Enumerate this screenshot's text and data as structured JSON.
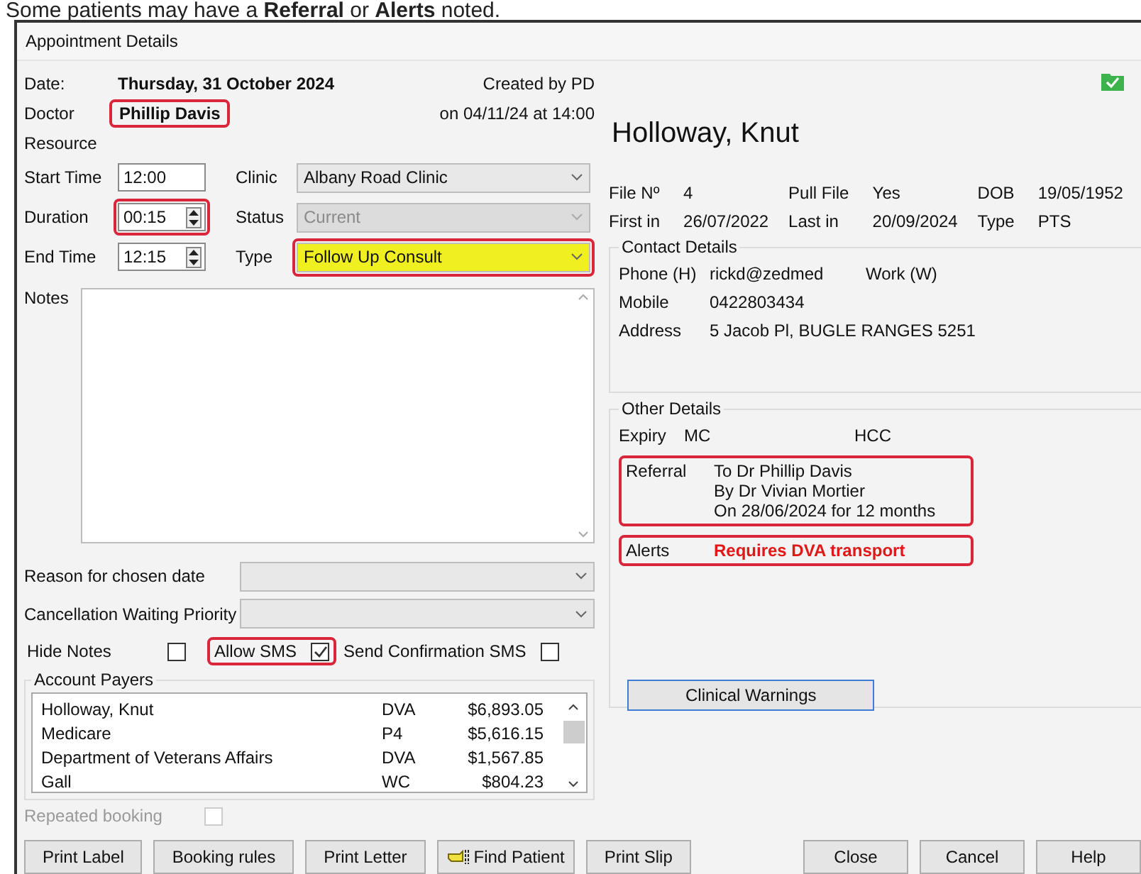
{
  "caption": "Some patients may have a **Referral** or **Alerts** noted.",
  "window": {
    "title": "Appointment Details"
  },
  "header": {
    "date_label": "Date:",
    "date": "Thursday, 31 October 2024",
    "created_by": "Created by PD",
    "doctor_label": "Doctor",
    "doctor": "Phillip Davis",
    "doctor_highlighted": true,
    "created_on": "on 04/11/24 at 14:00",
    "resource_label": "Resource"
  },
  "time_fields": [
    {
      "label": "Start Time",
      "value": "12:00",
      "spinner": false,
      "highlighted": false
    },
    {
      "label": "Duration",
      "value": "00:15",
      "spinner": true,
      "highlighted": true
    },
    {
      "label": "End Time",
      "value": "12:15",
      "spinner": true,
      "highlighted": false
    }
  ],
  "selects": [
    {
      "label": "Clinic",
      "value": "Albany Road Clinic",
      "disabled": false,
      "highlighted": false
    },
    {
      "label": "Status",
      "value": "Current",
      "disabled": true,
      "highlighted": false
    },
    {
      "label": "Type",
      "value": "Follow Up Consult",
      "disabled": false,
      "highlighted": true
    }
  ],
  "notes_label": "Notes",
  "wide_selects": [
    {
      "label": "Reason for chosen date"
    },
    {
      "label": "Cancellation Waiting Priority"
    }
  ],
  "checkboxes": [
    {
      "label": "Hide Notes",
      "checked": false,
      "highlighted": false
    },
    {
      "label": "Allow SMS",
      "checked": true,
      "highlighted": true
    },
    {
      "label": "Send Confirmation SMS",
      "checked": false,
      "highlighted": false
    }
  ],
  "account_payers": {
    "title": "Account Payers",
    "rows": [
      {
        "name": "Holloway, Knut",
        "code": "DVA",
        "amount": "$6,893.05"
      },
      {
        "name": "Medicare",
        "code": "P4",
        "amount": "$5,616.15"
      },
      {
        "name": "Department of Veterans Affairs",
        "code": "DVA",
        "amount": "$1,567.85"
      },
      {
        "name": "Gall",
        "code": "WC",
        "amount": "$804.23"
      }
    ]
  },
  "repeated_booking": {
    "label": "Repeated booking",
    "checked": false,
    "disabled": true
  },
  "left_buttons": [
    {
      "label": "Print Label"
    },
    {
      "label": "Booking rules"
    },
    {
      "label": "Print Letter"
    },
    {
      "label": "Find Patient",
      "kind": "icon"
    },
    {
      "label": "Print Slip"
    }
  ],
  "right_buttons": [
    {
      "label": "Close"
    },
    {
      "label": "Cancel"
    },
    {
      "label": "Help"
    }
  ],
  "patient": {
    "name": "Holloway, Knut",
    "info_rows": [
      [
        {
          "label": "File Nº",
          "value": "4"
        },
        {
          "label": "Pull File",
          "value": "Yes"
        },
        {
          "label": "DOB",
          "value": "19/05/1952"
        }
      ],
      [
        {
          "label": "First in",
          "value": "26/07/2022"
        },
        {
          "label": "Last in",
          "value": "20/09/2024"
        },
        {
          "label": "Type",
          "value": "PTS"
        }
      ]
    ],
    "contact": {
      "title": "Contact Details",
      "rows": [
        {
          "label": "Phone (H)",
          "value": "rickd@zedmed",
          "extra": "Work (W)"
        },
        {
          "label": "Mobile",
          "value": "0422803434"
        },
        {
          "label": "Address",
          "value": "5 Jacob Pl,  BUGLE RANGES 5251"
        }
      ]
    },
    "other": {
      "title": "Other Details",
      "expiry_label": "Expiry",
      "mc_label": "MC",
      "hcc_label": "HCC",
      "referral": {
        "label": "Referral",
        "lines": [
          "To Dr Phillip Davis",
          "By Dr Vivian Mortier",
          "On 28/06/2024 for  12 months"
        ],
        "highlighted": true
      },
      "alerts": {
        "label": "Alerts",
        "value": "Requires DVA transport",
        "highlighted": true
      },
      "button": "Clinical Warnings"
    }
  }
}
